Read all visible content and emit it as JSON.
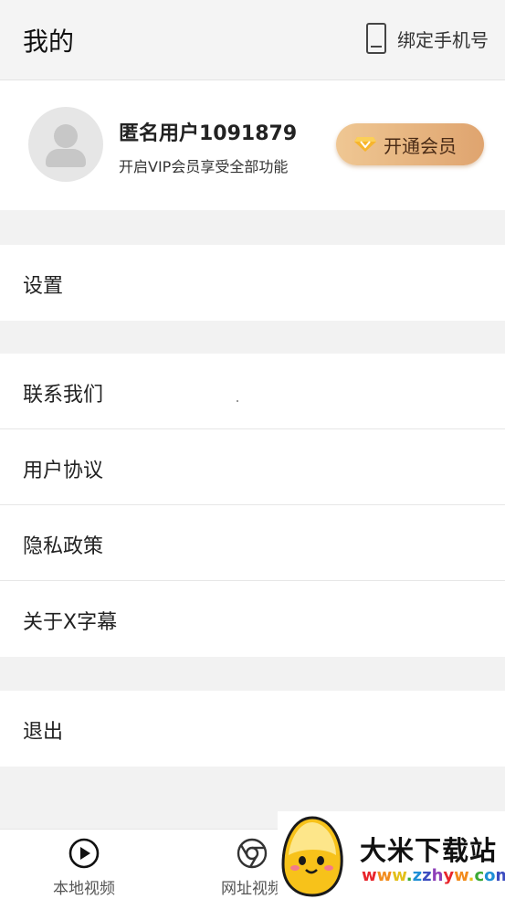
{
  "header": {
    "title": "我的",
    "bind_phone_label": "绑定手机号",
    "bind_phone_icon": "phone-icon"
  },
  "profile": {
    "username": "匿名用户1091879",
    "vip_note": "开启VIP会员享受全部功能",
    "vip_button_label": "开通会员",
    "vip_icon": "vip-diamond-icon"
  },
  "menu": {
    "group1": [
      {
        "label": "设置"
      }
    ],
    "group2": [
      {
        "label": "联系我们"
      },
      {
        "label": "用户协议"
      },
      {
        "label": "隐私政策"
      },
      {
        "label": "关于X字幕"
      }
    ],
    "group3": [
      {
        "label": "退出"
      }
    ]
  },
  "bottom_nav": [
    {
      "label": "本地视频",
      "icon": "play-circle-icon"
    },
    {
      "label": "网址视频",
      "icon": "browser-globe-icon"
    }
  ],
  "watermark": {
    "title": "大米下载站",
    "url": "www.zzhyw.com"
  },
  "colors": {
    "vip_gradient_start": "#efc793",
    "vip_gradient_end": "#dfa46f",
    "page_bg": "#f2f2f2"
  }
}
